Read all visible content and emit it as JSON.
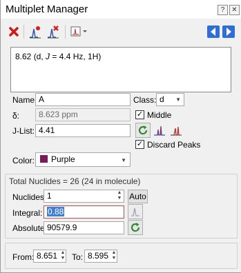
{
  "window": {
    "title": "Multiplet Manager",
    "help_label": "?",
    "close_label": "✕"
  },
  "toolbar": {
    "delete_icon": "red-x-icon",
    "arrow_left_icon": "blue-left-arrow",
    "arrow_right_icon": "blue-right-arrow"
  },
  "summary": {
    "prefix": "8.62 (d, ",
    "j_label": "J",
    "suffix": " = 4.4 Hz, 1H)"
  },
  "form": {
    "name_label": "Name:",
    "name_value": "A",
    "class_label": "Class:",
    "class_value": "d",
    "delta_label": "δ:",
    "delta_value": "8.623 ppm",
    "middle_label": "Middle",
    "middle_checked": true,
    "jlist_label": "J-List:",
    "jlist_value": "4.41",
    "discard_label": "Discard Peaks",
    "discard_checked": true,
    "color_label": "Color:",
    "color_value": "Purple",
    "color_hex": "#7a1a5c"
  },
  "nuclides": {
    "header": "Total Nuclides = 26 (24 in molecule)",
    "nuclides_label": "Nuclides:",
    "nuclides_value": "1",
    "auto_label": "Auto",
    "integral_label": "Integral:",
    "integral_value": "0.88",
    "absolute_label": "Absolute:",
    "absolute_value": "90579.9"
  },
  "range": {
    "from_label": "From:",
    "from_value": "8.651",
    "to_label": "To:",
    "to_value": "8.595"
  }
}
